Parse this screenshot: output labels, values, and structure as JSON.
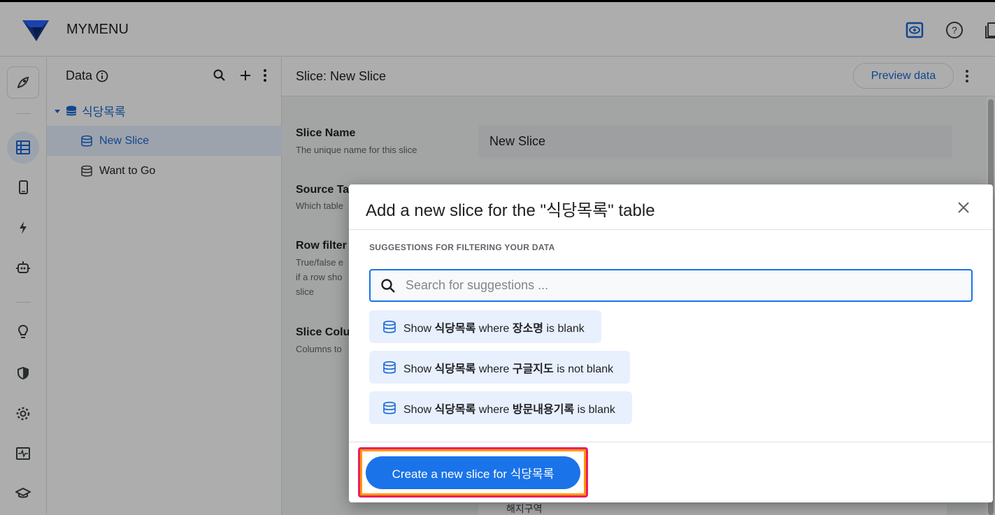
{
  "app": {
    "title": "MYMENU"
  },
  "data_panel": {
    "title": "Data",
    "table": "식당목록",
    "items": [
      {
        "label": "New Slice",
        "active": true
      },
      {
        "label": "Want to Go",
        "active": false
      }
    ]
  },
  "main": {
    "title": "Slice: New Slice",
    "preview_label": "Preview data",
    "fields": {
      "slice_name_label": "Slice Name",
      "slice_name_desc": "The unique name for this slice",
      "slice_name_value": "New Slice",
      "source_label": "Source Ta",
      "source_desc": "Which table",
      "row_filter_label": "Row filter",
      "row_filter_desc": "True/false e if a row sho slice",
      "columns_label": "Slice Colu",
      "columns_desc": "Columns to",
      "bottom_partial": "해지구역"
    }
  },
  "dialog": {
    "title": "Add a new slice for the \"식당목록\" table",
    "suggestions_heading": "SUGGESTIONS FOR FILTERING YOUR DATA",
    "search_placeholder": "Search for suggestions ...",
    "suggestions": [
      {
        "prefix": "Show",
        "table": "식당목록",
        "mid": "where",
        "column": "장소명",
        "condition": "is blank"
      },
      {
        "prefix": "Show",
        "table": "식당목록",
        "mid": "where",
        "column": "구글지도",
        "condition": "is not blank"
      },
      {
        "prefix": "Show",
        "table": "식당목록",
        "mid": "where",
        "column": "방문내용기록",
        "condition": "is blank"
      }
    ],
    "create_label": "Create a new slice for 식당목록"
  },
  "colors": {
    "accent": "#1a73e8",
    "highlight_outer": "#e91e63",
    "highlight_inner": "#ff9800"
  }
}
